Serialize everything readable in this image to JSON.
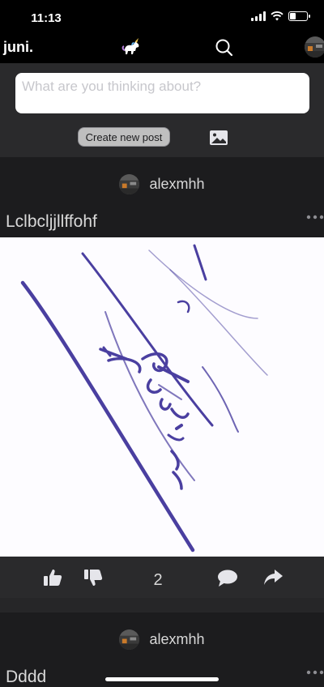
{
  "status_bar": {
    "time": "11:13",
    "battery_level": 0.3
  },
  "nav": {
    "brand": "juni.",
    "icons": [
      "unicorn-logo-icon",
      "search-icon",
      "profile-avatar"
    ]
  },
  "composer": {
    "placeholder": "What are you thinking about?",
    "value": "",
    "create_button_label": "Create new post",
    "image_icon": "image-upload-icon"
  },
  "posts": [
    {
      "author": "alexmhh",
      "title": "Lclbcljjllffohf",
      "image": "handwritten-signature-sketch",
      "vote_count": "2",
      "actions": [
        "like-icon",
        "dislike-icon",
        "comment-icon",
        "share-icon"
      ]
    },
    {
      "author": "alexmhh",
      "title": "Dddd"
    }
  ],
  "colors": {
    "background": "#1c1c1e",
    "bar": "#000000",
    "panel": "#2a2a2c",
    "text": "#d8d8d8",
    "ink": "#4a3fa0"
  }
}
